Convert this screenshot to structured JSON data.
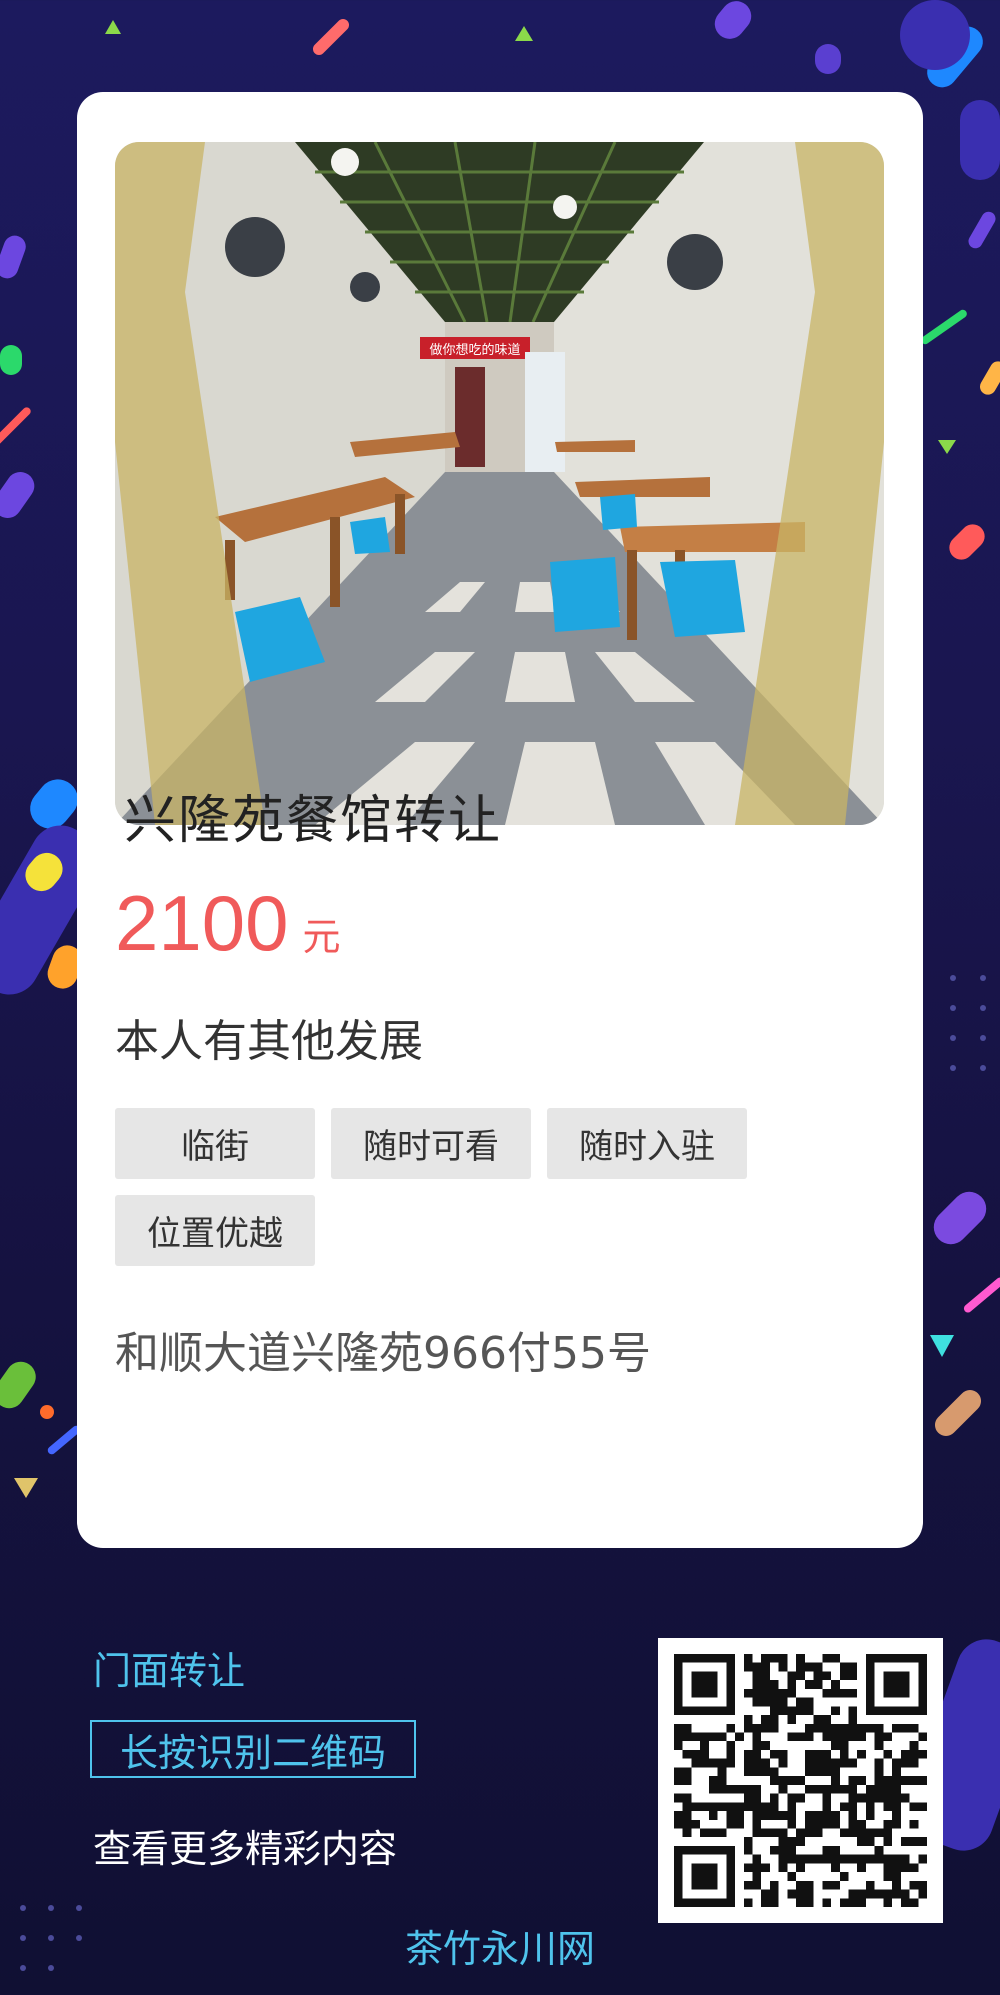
{
  "listing": {
    "title": "兴隆苑餐馆转让",
    "price_value": "2100",
    "price_unit": "元",
    "description": "本人有其他发展",
    "tags": [
      "临街",
      "随时可看",
      "随时入驻",
      "位置优越"
    ],
    "address": "和顺大道兴隆苑966付55号",
    "photo_sign_text": "做你想吃的味道"
  },
  "footer": {
    "category_label": "门面转让",
    "qr_button_label": "长按识别二维码",
    "more_label": "查看更多精彩内容",
    "brand_name": "茶竹永川网"
  },
  "colors": {
    "background": "#1a1650",
    "price": "#f05a5a",
    "accent": "#4fc3ec",
    "tag_bg": "#e6e6e6"
  },
  "icons": [
    "qr-code-icon"
  ]
}
